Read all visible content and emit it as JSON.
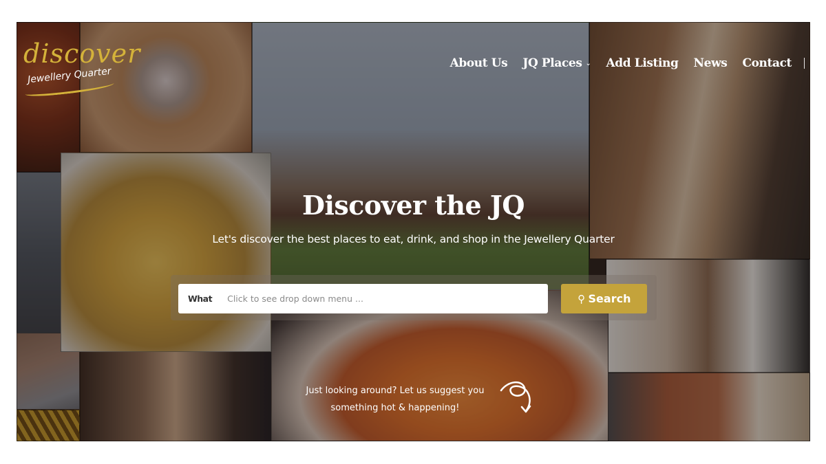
{
  "logo": {
    "main": "discover",
    "sub": "Jewellery Quarter",
    "accent_color": "#d4b23a"
  },
  "nav": {
    "items": [
      {
        "label": "About Us",
        "has_dropdown": false
      },
      {
        "label": "JQ Places",
        "has_dropdown": true,
        "dropdown_icon": "›"
      },
      {
        "label": "Add Listing",
        "has_dropdown": false
      },
      {
        "label": "News",
        "has_dropdown": false
      },
      {
        "label": "Contact",
        "has_dropdown": false
      }
    ]
  },
  "hero": {
    "title": "Discover the JQ",
    "subtitle": "Let's discover the best places to eat, drink, and shop in the Jewellery Quarter",
    "photos": [
      "diamond-ring",
      "fish-and-chips",
      "plaza-event",
      "couple-on-bike",
      "jeweller-at-work",
      "sushi",
      "couple-dining",
      "eaglesfield-signs",
      "gold-jewellery"
    ]
  },
  "search": {
    "label": "What",
    "placeholder": "Click to see drop down menu ...",
    "value": "",
    "button_label": "Search",
    "button_icon": "search-icon",
    "button_color": "#c4a33b"
  },
  "suggest": {
    "line1": "Just looking around? Let us suggest you",
    "line2": "something hot & happening!"
  }
}
